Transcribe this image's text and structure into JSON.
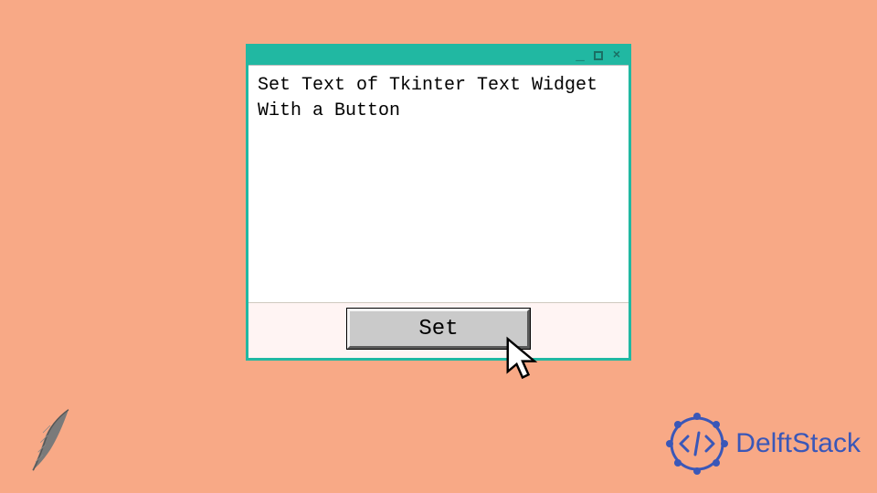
{
  "window": {
    "titlebar": {
      "minimize": "_",
      "maximize": "□",
      "close": "×"
    },
    "text_widget": {
      "content": "Set Text of Tkinter Text Widget With a Button"
    },
    "button": {
      "label": "Set"
    }
  },
  "brand": {
    "name": "DelftStack"
  },
  "colors": {
    "background": "#f8a986",
    "window_border": "#21b8a2",
    "brand": "#3a57b8"
  },
  "icons": {
    "cursor": "cursor-icon",
    "feather": "feather-icon",
    "brand_logo": "delftstack-logo-icon"
  }
}
